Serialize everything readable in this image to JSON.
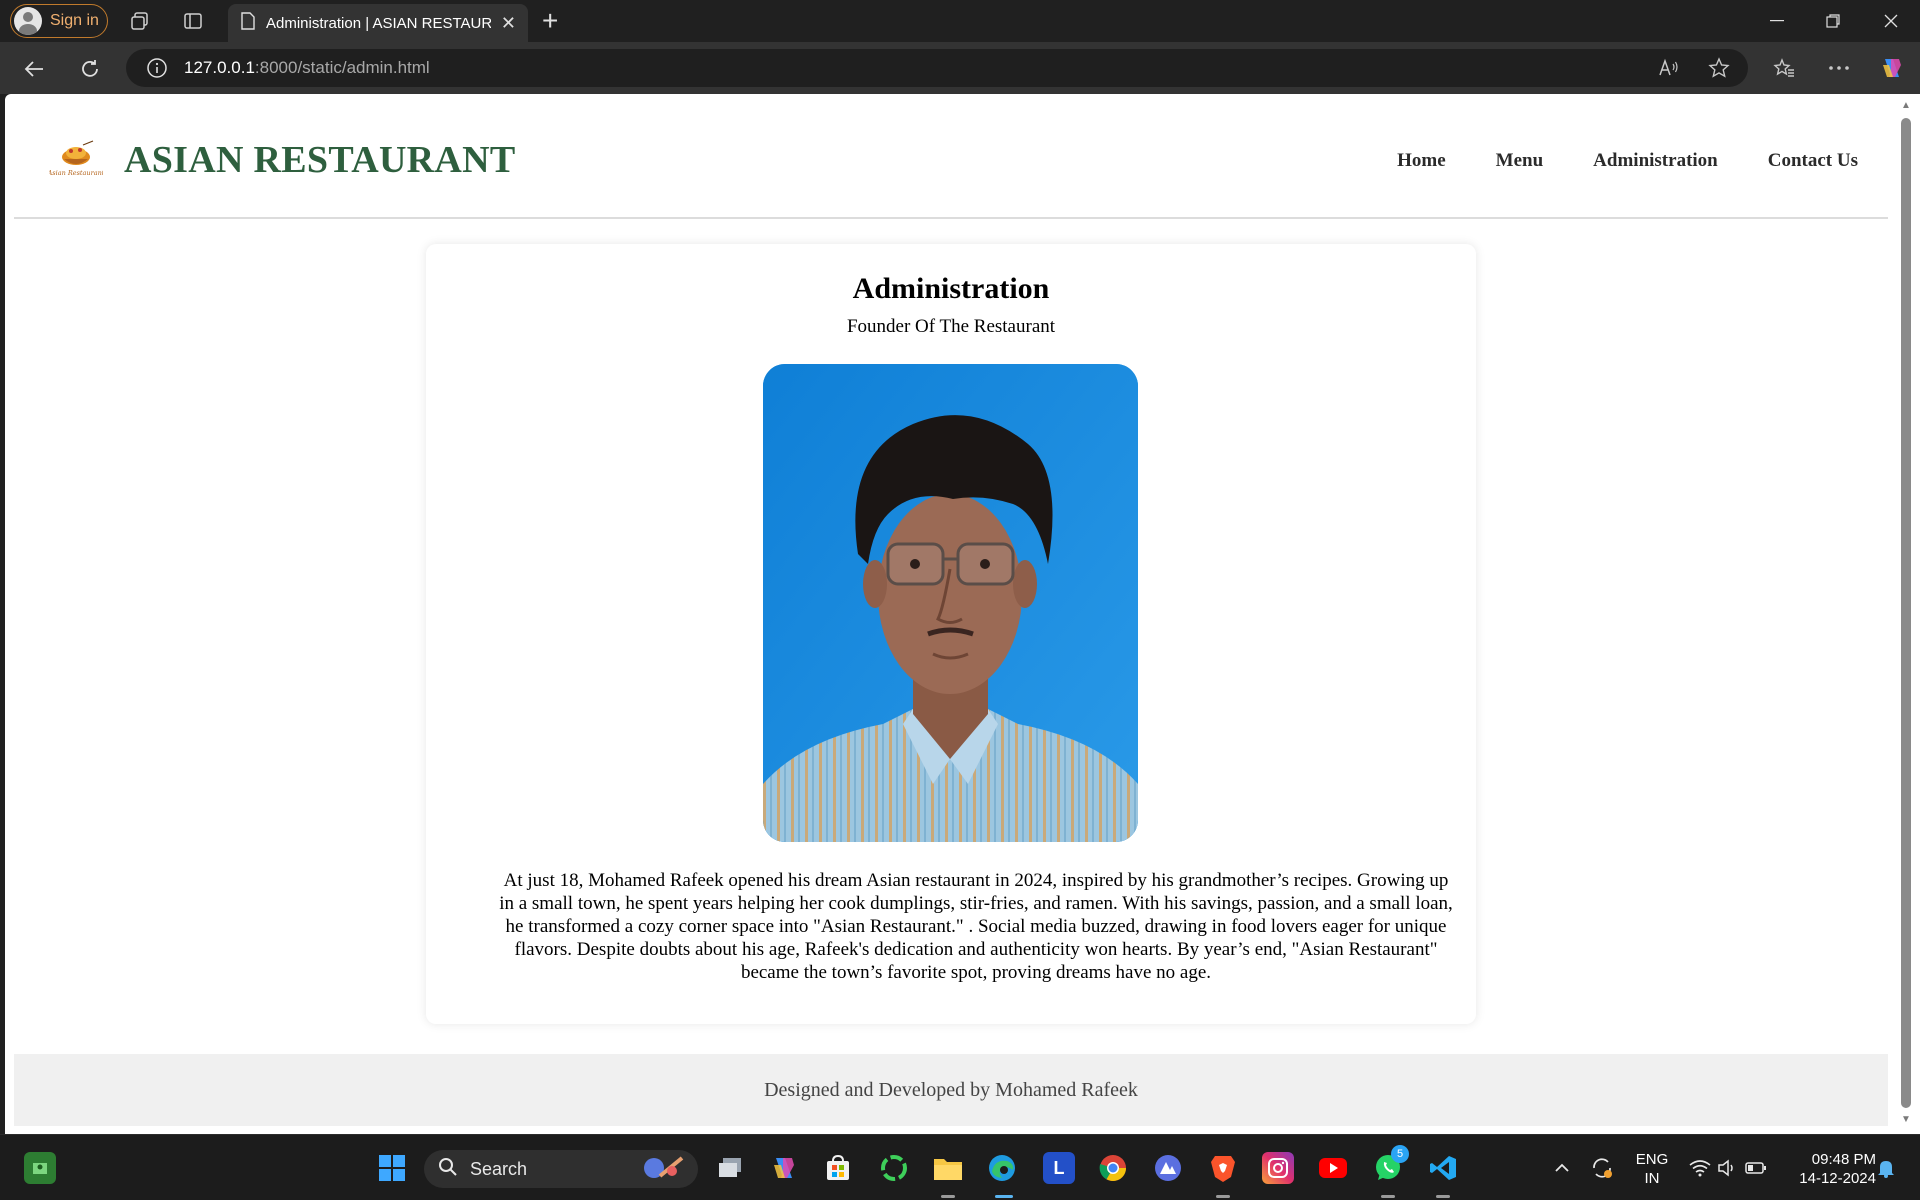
{
  "browser": {
    "signin_label": "Sign in",
    "tab_title": "Administration | ASIAN RESTAURANT",
    "url_host": "127.0.0.1",
    "url_path": ":8000/static/admin.html"
  },
  "site": {
    "title": "ASIAN RESTAURANT",
    "logo_text": "Asian Restaurant",
    "nav": {
      "home": "Home",
      "menu": "Menu",
      "administration": "Administration",
      "contact": "Contact Us"
    }
  },
  "admin": {
    "heading": "Administration",
    "subtitle": "Founder Of The Restaurant",
    "bio": "At just 18, Mohamed Rafeek opened his dream Asian restaurant in 2024, inspired by his grandmother’s recipes. Growing up in a small town, he spent years helping her cook dumplings, stir-fries, and ramen. With his savings, passion, and a small loan, he transformed a cozy corner space into \"Asian Restaurant.\" . Social media buzzed, drawing in food lovers eager for unique flavors. Despite doubts about his age, Rafeek's dedication and authenticity won hearts. By year’s end, \"Asian Restaurant\" became the town’s favorite spot, proving dreams have no age."
  },
  "footer": {
    "credit": "Designed and Developed by Mohamed Rafeek"
  },
  "taskbar": {
    "search_label": "Search",
    "app_l_label": "L",
    "whatsapp_badge": "5",
    "lang_top": "ENG",
    "lang_bottom": "IN",
    "time": "09:48 PM",
    "date": "14-12-2024"
  },
  "colors": {
    "brand_green": "#2e5f3e",
    "photo_background": "#1a8ee0",
    "footer_bg": "#f0f0f0"
  }
}
